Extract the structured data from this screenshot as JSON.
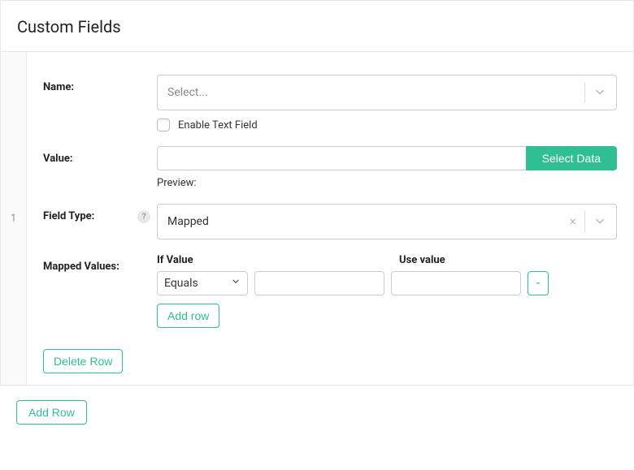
{
  "panel": {
    "title": "Custom Fields"
  },
  "row": {
    "index": "1",
    "name": {
      "label": "Name:",
      "select_placeholder": "Select...",
      "enable_text_label": "Enable Text Field"
    },
    "value": {
      "label": "Value:",
      "select_data_btn": "Select Data",
      "preview_label": "Preview:"
    },
    "field_type": {
      "label": "Field Type:",
      "value": "Mapped"
    },
    "mapped": {
      "label": "Mapped Values:",
      "if_value_header": "If Value",
      "use_value_header": "Use value",
      "condition": "Equals",
      "remove_btn": "-",
      "add_row_btn": "Add row"
    },
    "delete_row_btn": "Delete Row"
  },
  "footer": {
    "add_row_btn": "Add Row"
  }
}
